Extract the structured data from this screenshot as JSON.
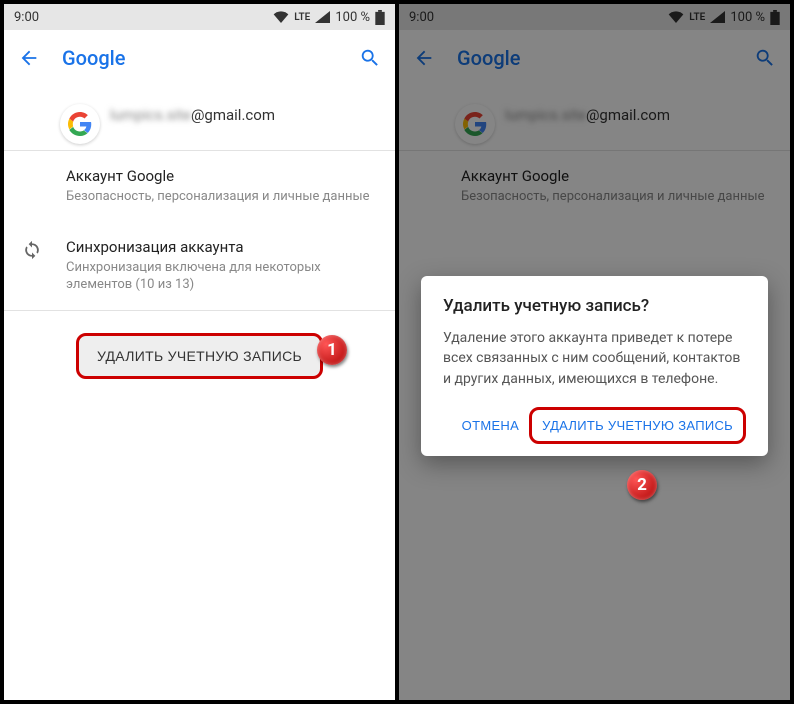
{
  "status": {
    "time": "9:00",
    "lte": "LTE",
    "battery": "100 %"
  },
  "appbar": {
    "title": "Google"
  },
  "account": {
    "email_prefix_blurred": "lumpics.site",
    "email_domain": "@gmail.com"
  },
  "settings": {
    "google_account": {
      "label": "Аккаунт Google",
      "sub": "Безопасность, персонализация и личные данные"
    },
    "sync": {
      "label": "Синхронизация аккаунта",
      "sub": "Синхронизация включена для некоторых элементов (10 из 13)"
    }
  },
  "remove_button": "УДАЛИТЬ УЧЕТНУЮ ЗАПИСЬ",
  "dialog": {
    "title": "Удалить учетную запись?",
    "body": "Удаление этого аккаунта приведет к потере всех связанных с ним сообщений, контактов и других данных, имеющихся в телефоне.",
    "cancel": "ОТМЕНА",
    "confirm": "УДАЛИТЬ УЧЕТНУЮ ЗАПИСЬ"
  },
  "badges": {
    "one": "1",
    "two": "2"
  }
}
